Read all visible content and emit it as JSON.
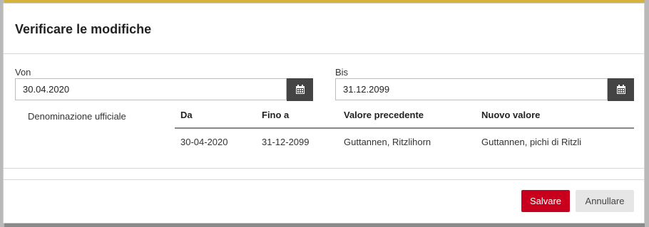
{
  "dialog": {
    "title": "Verificare le modifiche"
  },
  "fields": {
    "from": {
      "label": "Von",
      "value": "30.04.2020"
    },
    "to": {
      "label": "Bis",
      "value": "31.12.2099"
    }
  },
  "changes": {
    "row_label": "Denominazione ufficiale",
    "columns": [
      "Da",
      "Fino a",
      "Valore precedente",
      "Nuovo valore"
    ],
    "rows": [
      [
        "30-04-2020",
        "31-12-2099",
        "Guttannen, Ritzlihorn",
        "Guttannen, pichi di Ritzli"
      ]
    ]
  },
  "footer": {
    "save_label": "Salvare",
    "cancel_label": "Annullare"
  },
  "colors": {
    "primary": "#c8001e",
    "icon_button": "#444444"
  },
  "icons": {
    "calendar": "calendar-icon"
  }
}
